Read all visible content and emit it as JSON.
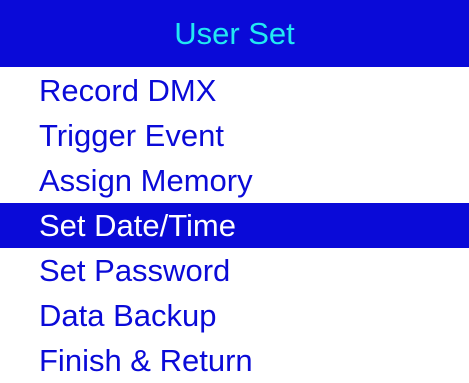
{
  "header": {
    "title": "User Set"
  },
  "menu": {
    "selected_index": 3,
    "items": [
      {
        "label": "Record DMX"
      },
      {
        "label": "Trigger Event"
      },
      {
        "label": "Assign Memory"
      },
      {
        "label": "Set Date/Time"
      },
      {
        "label": "Set Password"
      },
      {
        "label": "Data Backup"
      },
      {
        "label": "Finish & Return"
      }
    ]
  },
  "colors": {
    "accent": "#0a0ad8",
    "header_text": "#22e8f2",
    "selected_text": "#ffffff",
    "background": "#ffffff"
  }
}
